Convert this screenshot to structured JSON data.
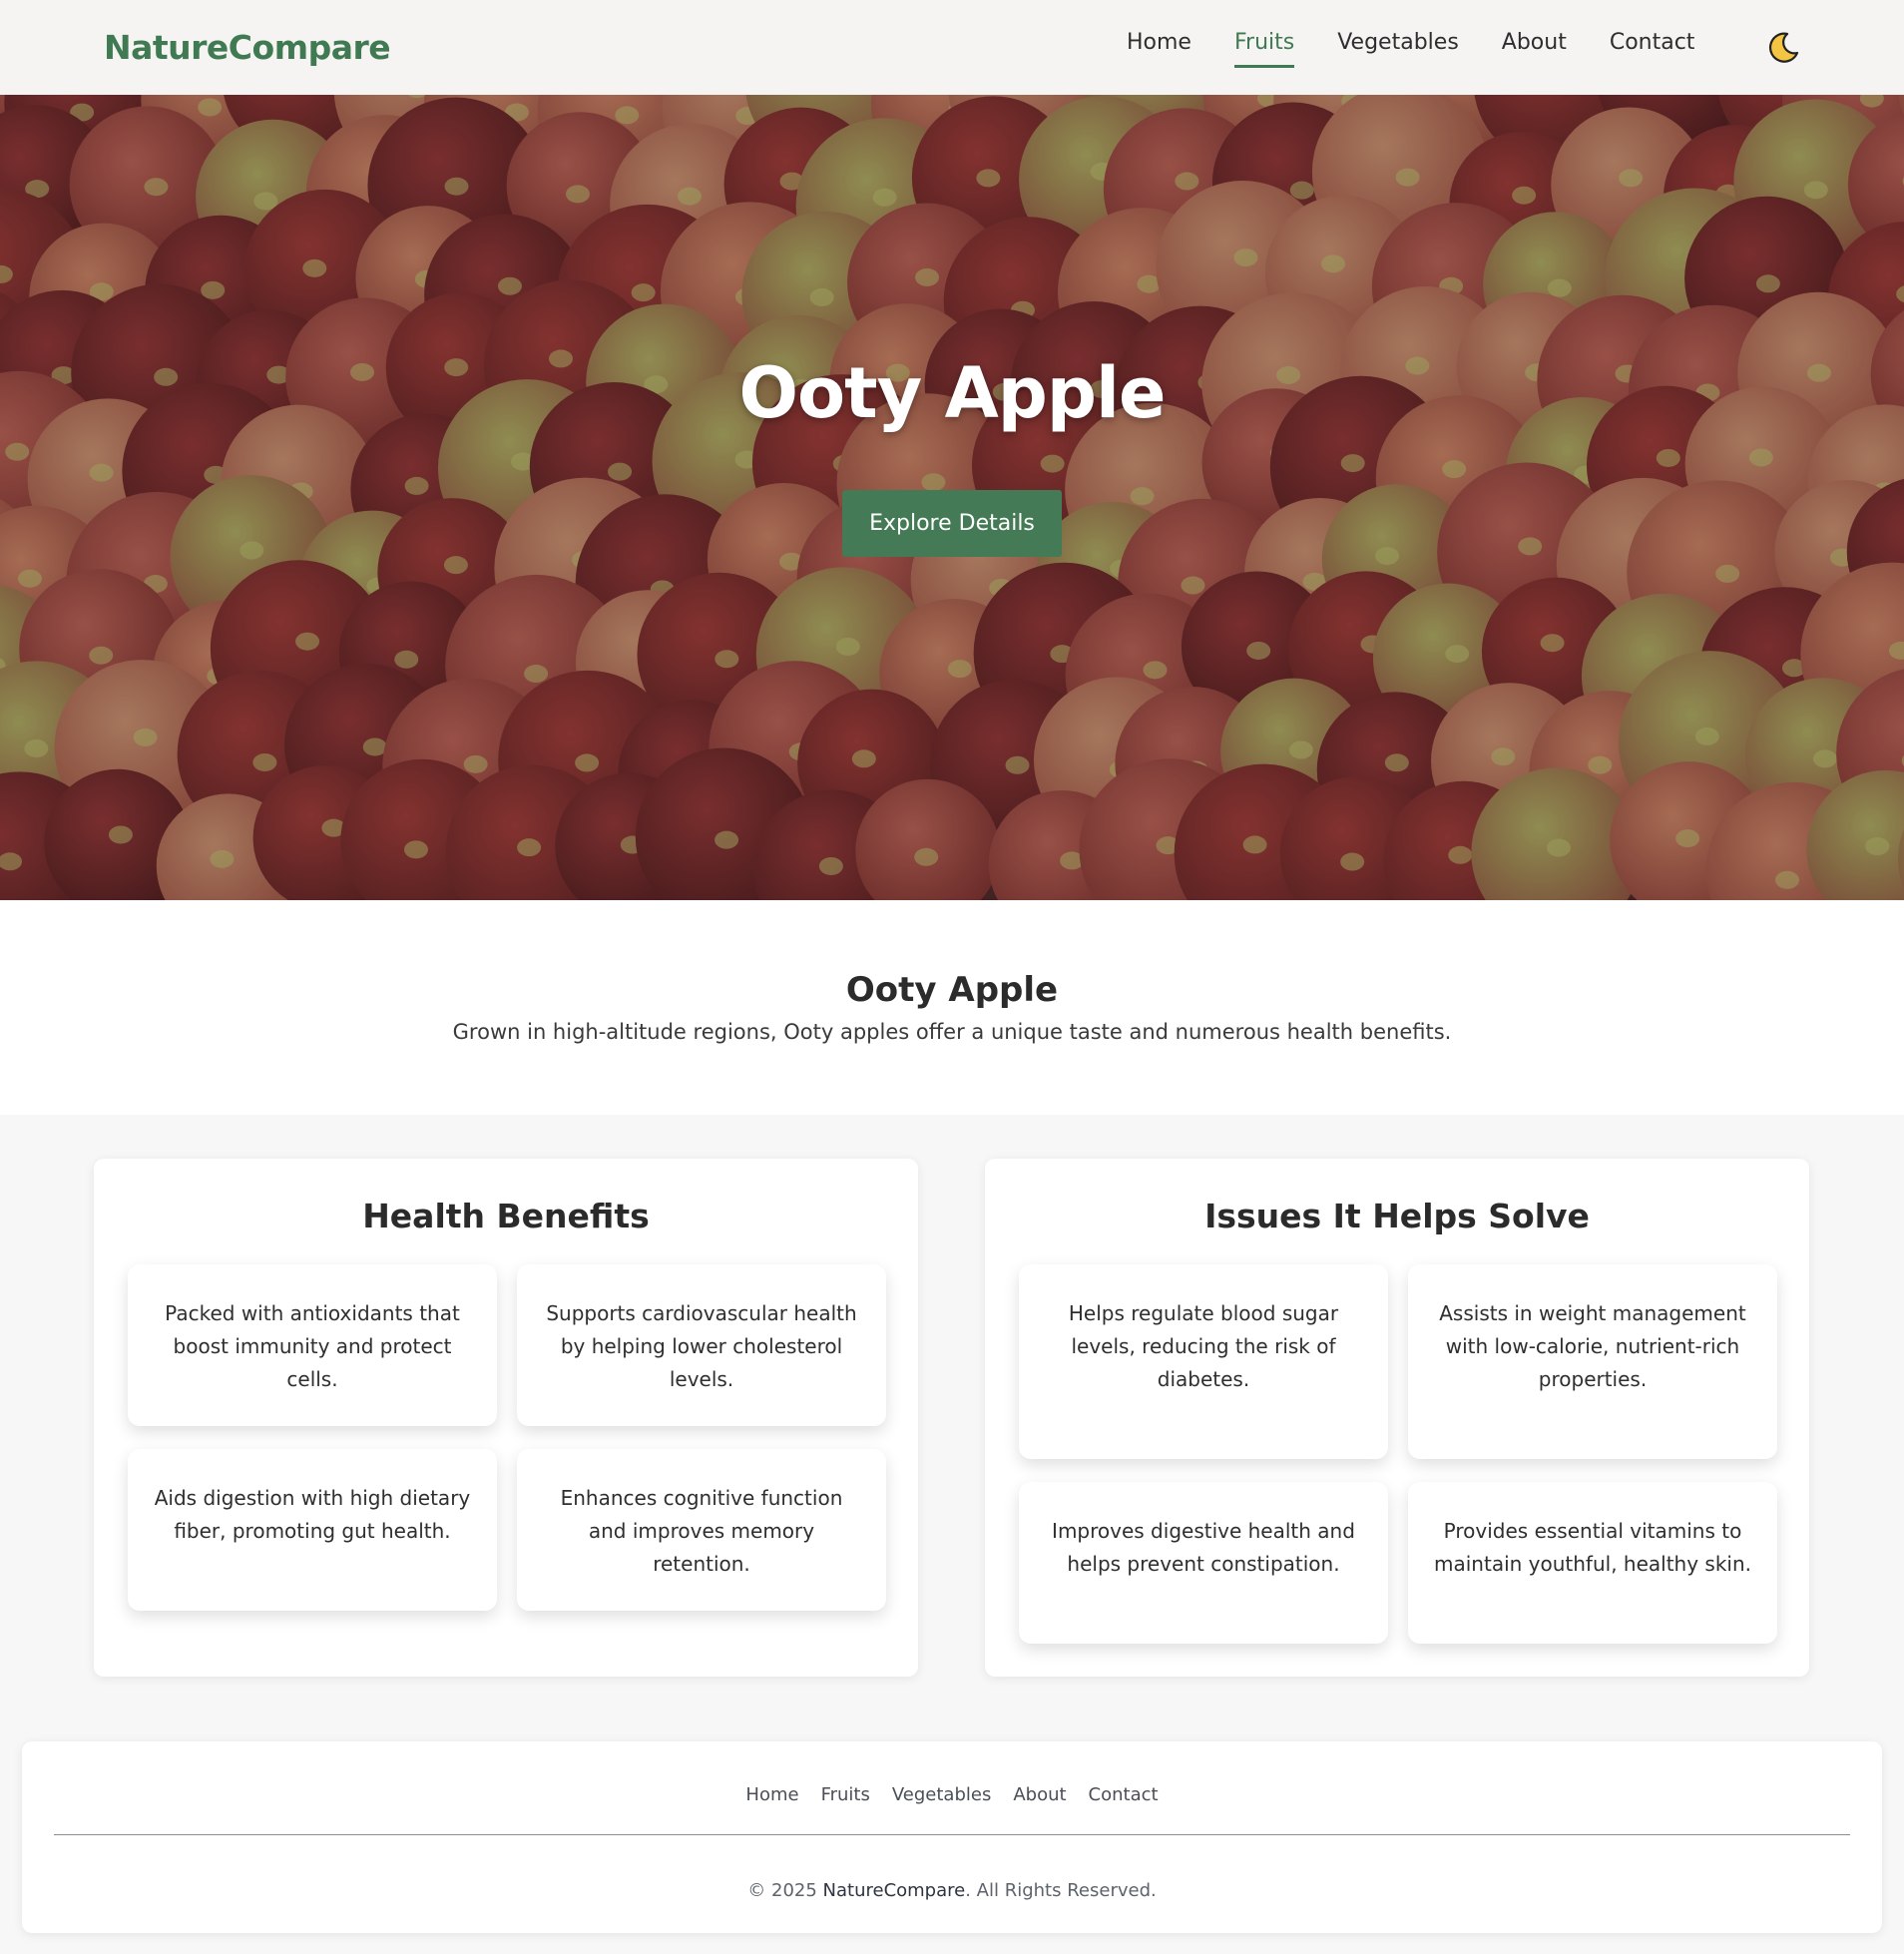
{
  "header": {
    "logo": "NatureCompare",
    "nav": [
      {
        "label": "Home",
        "active": false
      },
      {
        "label": "Fruits",
        "active": true
      },
      {
        "label": "Vegetables",
        "active": false
      },
      {
        "label": "About",
        "active": false
      },
      {
        "label": "Contact",
        "active": false
      }
    ],
    "theme_toggle_icon": "moon-icon"
  },
  "hero": {
    "title": "Ooty Apple",
    "button_label": "Explore Details",
    "background_image": "pile of red apples"
  },
  "intro": {
    "title": "Ooty Apple",
    "description": "Grown in high-altitude regions, Ooty apples offer a unique taste and numerous health benefits."
  },
  "health_benefits": {
    "title": "Health Benefits",
    "items": [
      "Packed with antioxidants that boost immunity and protect cells.",
      "Supports cardiovascular health by helping lower cholesterol levels.",
      "Aids digestion with high dietary fiber, promoting gut health.",
      "Enhances cognitive function and improves memory retention."
    ]
  },
  "issues": {
    "title": "Issues It Helps Solve",
    "items": [
      "Helps regulate blood sugar levels, reducing the risk of diabetes.",
      "Assists in weight management with low-calorie, nutrient-rich properties.",
      "Improves digestive health and helps prevent constipation.",
      "Provides essential vitamins to maintain youthful, healthy skin."
    ]
  },
  "footer": {
    "links": [
      "Home",
      "Fruits",
      "Vegetables",
      "About",
      "Contact"
    ],
    "copyright_prefix": "© 2025 ",
    "copyright_brand": "NatureCompare",
    "copyright_suffix": ". All Rights Reserved."
  },
  "colors": {
    "brand_green": "#3f7a52",
    "button_green": "#447a55",
    "apple_red": "#8e3a38"
  }
}
